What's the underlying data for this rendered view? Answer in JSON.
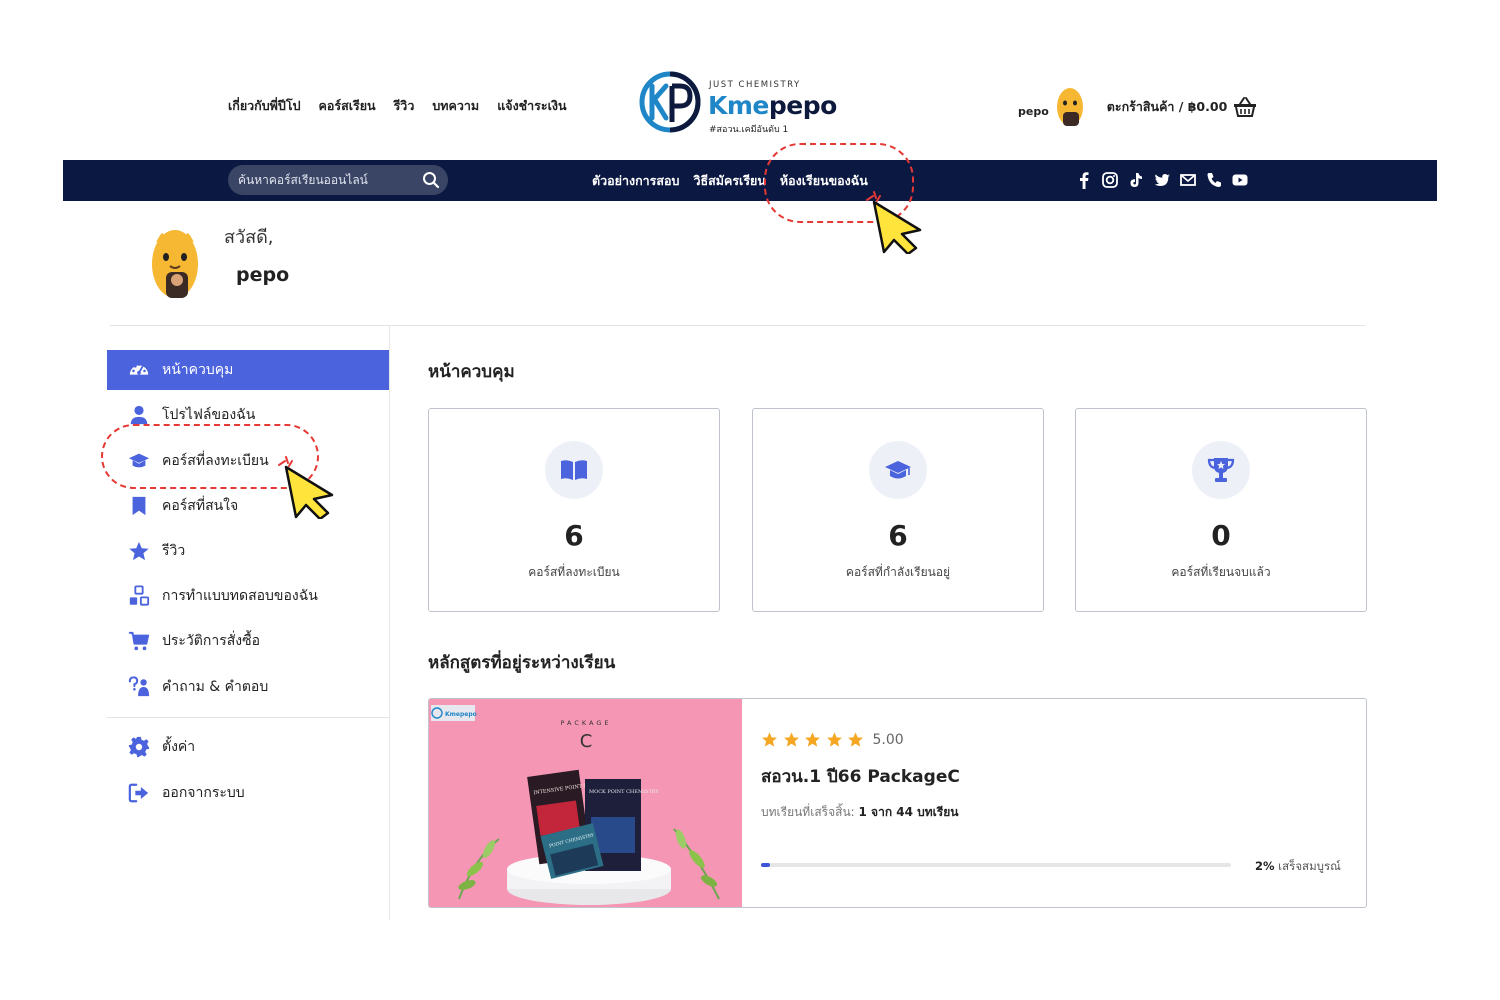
{
  "header": {
    "nav": [
      "เกี่ยวกับพี่ปีโป",
      "คอร์สเรียน",
      "รีวิว",
      "บทความ",
      "แจ้งชำระเงิน"
    ],
    "logo": {
      "tagline": "JUST CHEMISTRY",
      "name_a": "Kme",
      "name_b": "pepo",
      "subtitle": "#สอวน.เคมีอันดับ 1"
    },
    "username": "pepo",
    "cart_label": "ตะกร้าสินค้า / ฿0.00"
  },
  "bluebar": {
    "search_placeholder": "ค้นหาคอร์สเรียนออนไลน์",
    "nav": [
      "ตัวอย่างการสอบ",
      "วิธีสมัครเรียน",
      "ห้องเรียนของฉัน"
    ],
    "active_index": 2,
    "social_icons": [
      "facebook-icon",
      "instagram-icon",
      "tiktok-icon",
      "twitter-icon",
      "mail-icon",
      "phone-icon",
      "youtube-icon"
    ]
  },
  "greeting": {
    "hello": "สวัสดี,",
    "name": "pepo"
  },
  "sidebar": {
    "items": [
      {
        "label": "หน้าควบคุม",
        "icon": "dashboard-icon",
        "active": true
      },
      {
        "label": "โปรไฟล์ของฉัน",
        "icon": "user-icon"
      },
      {
        "label": "คอร์สที่ลงทะเบียน",
        "icon": "graduation-cap-icon"
      },
      {
        "label": "คอร์สที่สนใจ",
        "icon": "bookmark-icon"
      },
      {
        "label": "รีวิว",
        "icon": "star-icon"
      },
      {
        "label": "การทำแบบทดสอบของฉัน",
        "icon": "quiz-icon"
      },
      {
        "label": "ประวัติการสั่งซื้อ",
        "icon": "cart-icon"
      },
      {
        "label": "คำถาม & คำตอบ",
        "icon": "question-icon"
      }
    ],
    "bottom_items": [
      {
        "label": "ตั้งค่า",
        "icon": "gear-icon"
      },
      {
        "label": "ออกจากระบบ",
        "icon": "logout-icon"
      }
    ]
  },
  "main": {
    "title": "หน้าควบคุม",
    "stats": [
      {
        "icon": "book-icon",
        "value": "6",
        "label": "คอร์สที่ลงทะเบียน"
      },
      {
        "icon": "graduation-cap-icon",
        "value": "6",
        "label": "คอร์สที่กำลังเรียนอยู่"
      },
      {
        "icon": "trophy-icon",
        "value": "0",
        "label": "คอร์สที่เรียนจบแล้ว"
      }
    ],
    "in_progress_title": "หลักสูตรที่อยู่ระหว่างเรียน",
    "course": {
      "rating": "5.00",
      "stars": 5,
      "title": "สอวน.1 ปี66 PackageC",
      "progress_prefix": "บทเรียนที่เสร็จสิ้น:",
      "progress_detail": "1 จาก 44 บทเรียน",
      "progress_pct": 2,
      "progress_label_bold": "2%",
      "progress_label_rest": " เสร็จสมบูรณ์",
      "thumb_logo": "Kmepepo",
      "thumb_package": "PACKAGE",
      "thumb_letter": "C",
      "thumb_book1": "INTENSIVE POINT CHEMISTRY",
      "thumb_book2": "MOCK POINT CHEMISTRY",
      "thumb_book3": "POINT CHEMISTRY"
    }
  },
  "colors": {
    "navy": "#0b1842",
    "accent": "#4b63dc",
    "annotation": "#e53935",
    "cursor": "#ffe43b"
  }
}
